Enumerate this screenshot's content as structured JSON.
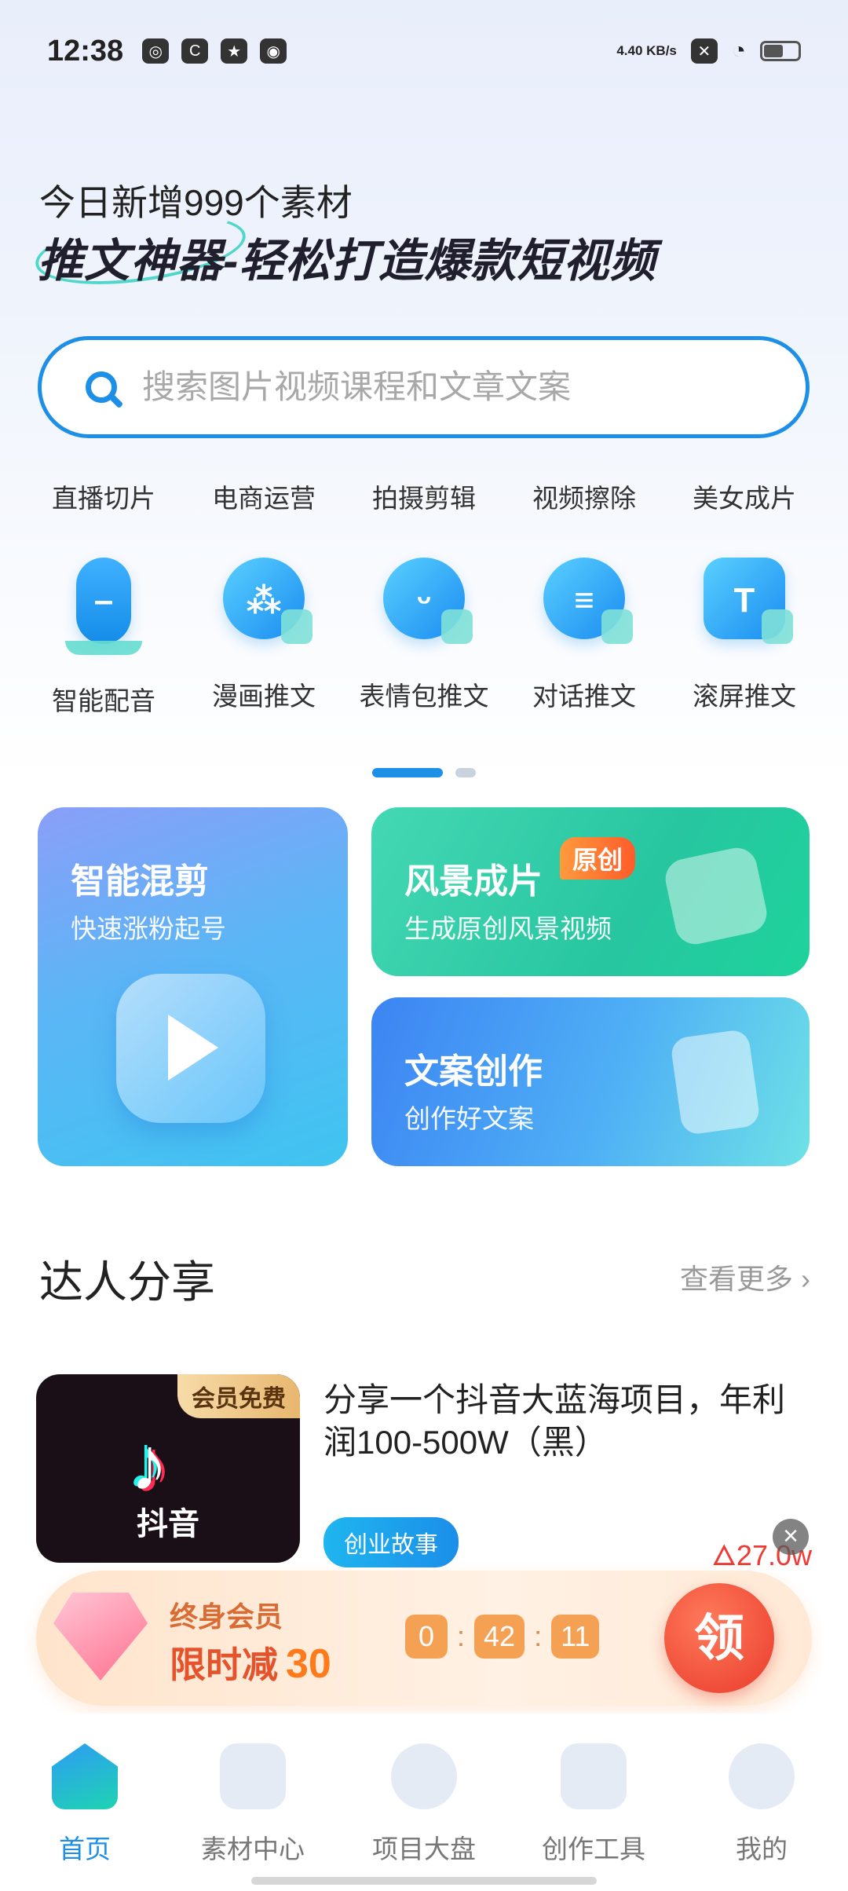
{
  "status": {
    "time": "12:38",
    "kbs": "4.40 KB/s"
  },
  "header": {
    "line1": "今日新增999个素材",
    "line2": "推文神器-轻松打造爆款短视频"
  },
  "search": {
    "placeholder": "搜索图片视频课程和文章文案"
  },
  "categories": [
    "直播切片",
    "电商运营",
    "拍摄剪辑",
    "视频擦除",
    "美女成片"
  ],
  "tools": [
    {
      "label": "智能配音",
      "icon": "microphone-icon"
    },
    {
      "label": "漫画推文",
      "icon": "palette-icon"
    },
    {
      "label": "表情包推文",
      "icon": "smiley-icon"
    },
    {
      "label": "对话推文",
      "icon": "chat-icon"
    },
    {
      "label": "滚屏推文",
      "icon": "text-t-icon"
    }
  ],
  "cards": {
    "mix": {
      "title": "智能混剪",
      "subtitle": "快速涨粉起号"
    },
    "scenery": {
      "title": "风景成片",
      "subtitle": "生成原创风景视频",
      "badge": "原创"
    },
    "copy": {
      "title": "文案创作",
      "subtitle": "创作好文案"
    }
  },
  "section": {
    "title": "达人分享",
    "more": "查看更多"
  },
  "article": {
    "badge": "会员免费",
    "thumb_label": "抖音",
    "title": "分享一个抖音大蓝海项目，年利润100-500W（黑）",
    "tag": "创业故事",
    "views": "27.0w"
  },
  "promo": {
    "line1": "终身会员",
    "line2": "限时减",
    "amount": "30",
    "countdown": [
      "0",
      "42",
      "11"
    ],
    "cta": "领"
  },
  "tabs": [
    {
      "label": "首页",
      "active": true
    },
    {
      "label": "素材中心"
    },
    {
      "label": "项目大盘"
    },
    {
      "label": "创作工具"
    },
    {
      "label": "我的"
    }
  ],
  "colors": {
    "accent": "#1d8fe6",
    "promo_red": "#e93b2c"
  }
}
